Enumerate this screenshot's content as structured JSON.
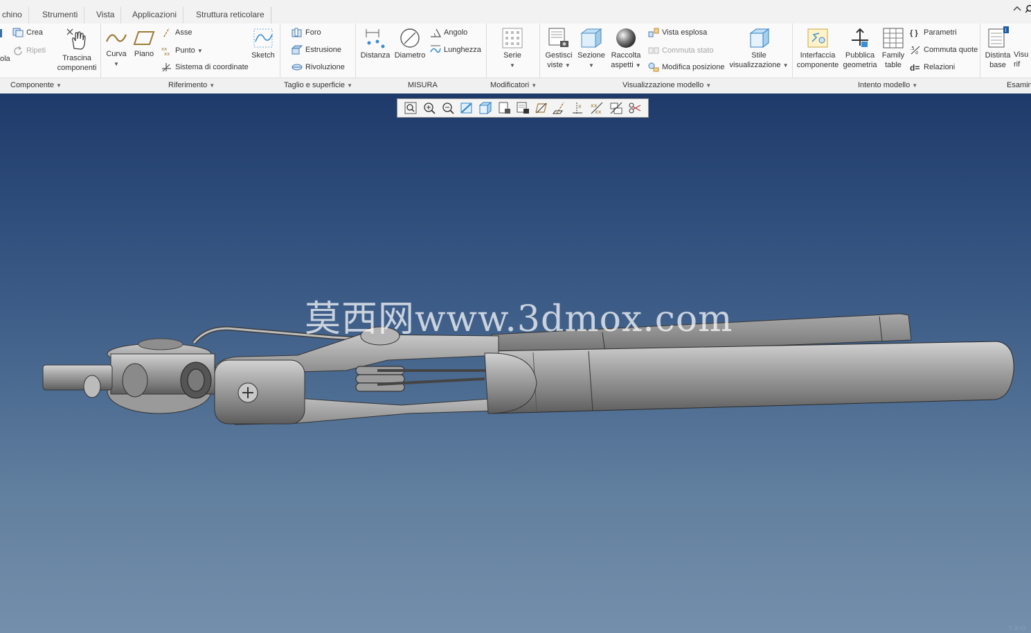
{
  "tabs": [
    "chino",
    "Strumenti",
    "Vista",
    "Applicazioni",
    "Struttura reticolare"
  ],
  "ribbon": {
    "crea": "Crea",
    "ripeti": "Ripeti",
    "ola": "ola",
    "trascina_1": "Trascina",
    "trascina_2": "componenti",
    "curva": "Curva",
    "piano": "Piano",
    "asse": "Asse",
    "punto": "Punto",
    "sistema": "Sistema di coordinate",
    "sketch": "Sketch",
    "foro": "Foro",
    "estrusione": "Estrusione",
    "rivoluzione": "Rivoluzione",
    "distanza": "Distanza",
    "diametro": "Diametro",
    "angolo": "Angolo",
    "lunghezza": "Lunghezza",
    "serie": "Serie",
    "gestisci_1": "Gestisci",
    "gestisci_2": "viste",
    "sezione": "Sezione",
    "raccolta_1": "Raccolta",
    "raccolta_2": "aspetti",
    "vista_esplosa": "Vista esplosa",
    "commuta_stato": "Commuta stato",
    "modifica_posizione": "Modifica posizione",
    "stile_1": "Stile",
    "stile_2": "visualizzazione",
    "interfaccia_1": "Interfaccia",
    "interfaccia_2": "componente",
    "pubblica_1": "Pubblica",
    "pubblica_2": "geometria",
    "family_1": "Family",
    "family_2": "table",
    "parametri": "Parametri",
    "commuta_quote": "Commuta quote",
    "relazioni": "Relazioni",
    "distinta_1": "Distinta",
    "distinta_2": "base",
    "visu_1": "Visu",
    "visu_2": "rif"
  },
  "groups": {
    "componente": "Componente",
    "riferimento": "Riferimento",
    "taglio": "Taglio e superficie",
    "misura": "MISURA",
    "modificatori": "Modificatori",
    "visualizzazione": "Visualizzazione modello",
    "intento": "Intento modello",
    "esamina": "Esamin"
  },
  "viewport": {
    "watermark": "莫西网www.3dmox.com",
    "coords": "Y X+0"
  },
  "view_toolbar_icons": [
    "zoom-fit-icon",
    "zoom-in-icon",
    "zoom-out-icon",
    "repaint-icon",
    "display-style-icon",
    "saved-views-icon",
    "view-manager-icon",
    "plane-display-icon",
    "axis-display-icon",
    "point-display-icon",
    "csys-display-icon",
    "annotation-display-icon",
    "spin-center-icon"
  ]
}
